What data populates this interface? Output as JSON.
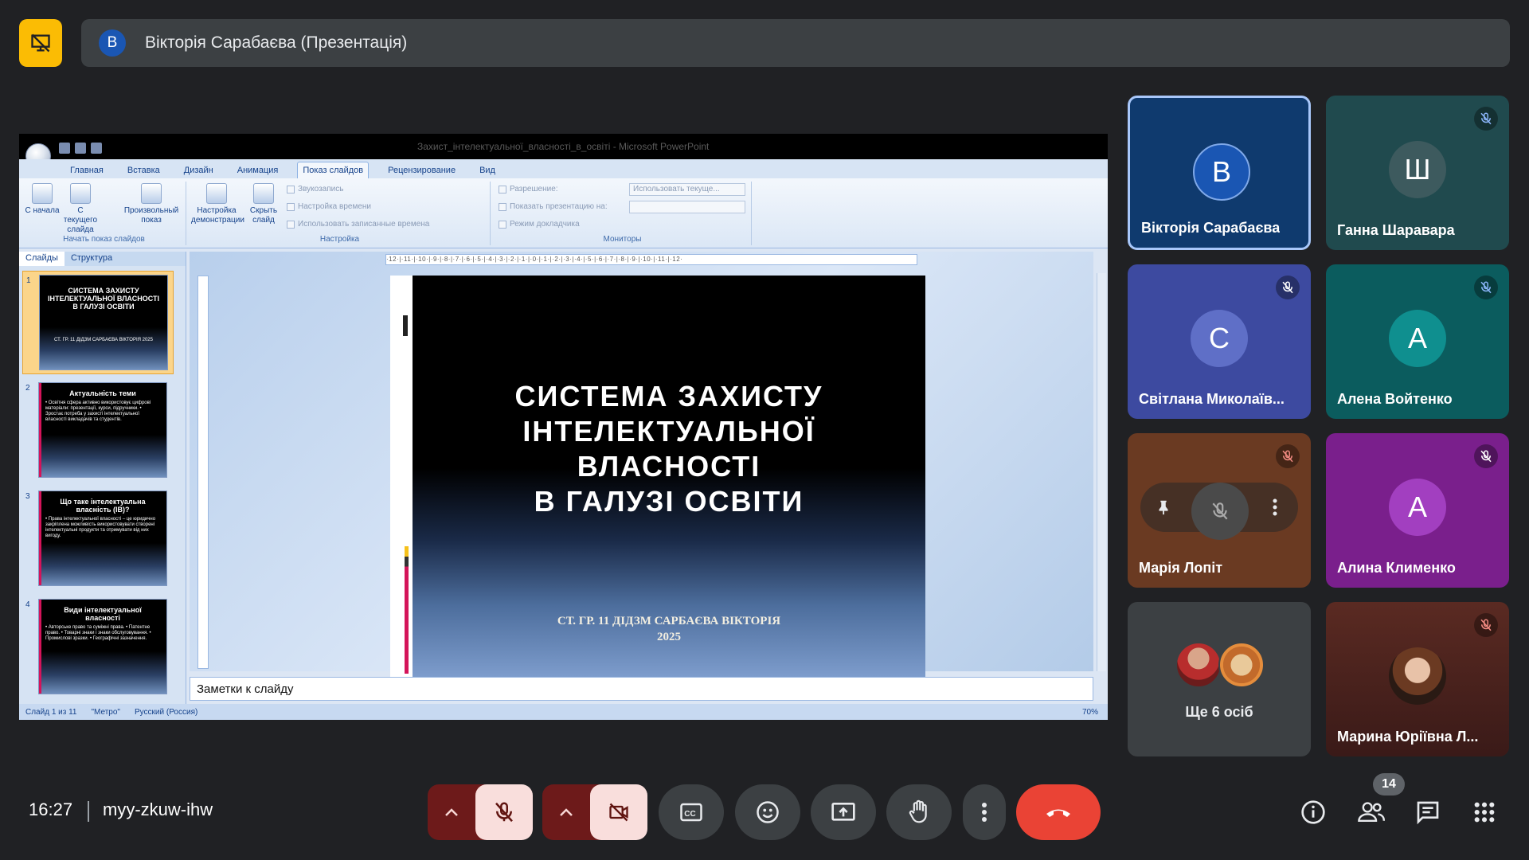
{
  "presenter_bar": {
    "avatar_letter": "В",
    "title": "Вікторія Сарабаєва (Презентація)"
  },
  "powerpoint": {
    "doc_title": "Захист_інтелектуальної_власності_в_освіті - Microsoft PowerPoint",
    "tabs": [
      "Главная",
      "Вставка",
      "Дизайн",
      "Анимация",
      "Показ слайдов",
      "Рецензирование",
      "Вид"
    ],
    "active_tab": "Показ слайдов",
    "ribbon": {
      "group1_label": "Начать показ слайдов",
      "btn_from_start": "С начала",
      "btn_from_current": "С текущего слайда",
      "btn_custom": "Произвольный показ",
      "group2_label": "Настройка",
      "btn_setup": "Настройка демонстрации",
      "btn_hide": "Скрыть слайд",
      "opt_record": "Звукозапись",
      "opt_rehearse": "Настройка времени",
      "opt_use_timings": "Использовать записанные времена",
      "group3_label": "Мониторы",
      "resolution_label": "Разрешение:",
      "resolution_value": "Использовать текуще...",
      "show_on_label": "Показать презентацию на:",
      "presenter_view": "Режим докладчика"
    },
    "panel_tabs": [
      "Слайды",
      "Структура"
    ],
    "thumbnails": [
      {
        "num": "1",
        "title": "СИСТЕМА ЗАХИСТУ ІНТЕЛЕКТУАЛЬНОЇ ВЛАСНОСТІ В ГАЛУЗІ ОСВІТИ",
        "body": "СТ. ГР. 11 ДІДЗМ САРБАЄВА ВІКТОРІЯ 2025"
      },
      {
        "num": "2",
        "title": "Актуальність теми",
        "body": "• Освітня сфера активно використовує цифрові матеріали: презентації, курси, підручники. • Зростає потреба у захисті інтелектуальної власності викладачів та студентів."
      },
      {
        "num": "3",
        "title": "Що таке інтелектуальна власність (ІВ)?",
        "body": "• Права інтелектуальної власності – це юридично закріплена можливість використовувати створені інтелектуальні продукти та отримувати від них вигоду."
      },
      {
        "num": "4",
        "title": "Види інтелектуальної власності",
        "body": "• Авторське право та суміжні права. • Патентне право. • Товарні знаки і знаки обслуговування. • Промислові зразки. • Географічні зазначення."
      }
    ],
    "ruler_text": "·12·|·11·|·10·|·9·|·8·|·7·|·6·|·5·|·4·|·3·|·2·|·1·|·0·|·1·|·2·|·3·|·4·|·5·|·6·|·7·|·8·|·9·|·10·|·11·|·12·",
    "slide": {
      "title_line1": "СИСТЕМА ЗАХИСТУ",
      "title_line2": "ІНТЕЛЕКТУАЛЬНОЇ",
      "title_line3": "ВЛАСНОСТІ",
      "title_line4": "В ГАЛУЗІ ОСВІТИ",
      "subtitle_line1": "СТ. ГР. 11 ДІДЗМ САРБАЄВА ВІКТОРІЯ",
      "subtitle_line2": "2025"
    },
    "notes_placeholder": "Заметки к слайду",
    "status": {
      "slide_count": "Слайд 1 из 11",
      "theme": "\"Метро\"",
      "language": "Русский (Россия)",
      "zoom": "70%"
    }
  },
  "participants": [
    {
      "letter": "В",
      "name": "Вікторія Сарабаєва",
      "color": "#1a56b3",
      "bg": "#0f3a6e",
      "muted": false,
      "active": true
    },
    {
      "letter": "Ш",
      "name": "Ганна Шаравара",
      "color": "#3d5a5e",
      "bg": "#204a4e",
      "muted": true,
      "active": false
    },
    {
      "letter": "С",
      "name": "Світлана Миколаїв...",
      "color": "#5f6fc7",
      "bg": "#3d4aa0",
      "muted": true,
      "active": false
    },
    {
      "letter": "А",
      "name": "Алена Войтенко",
      "color": "#0f8f8f",
      "bg": "#0b5c5e",
      "muted": true,
      "active": false
    },
    {
      "letter": "",
      "name": "Марія Лопіт",
      "color": "#555",
      "bg": "#6a3a22",
      "muted": true,
      "active": false
    },
    {
      "letter": "А",
      "name": "Алина Клименко",
      "color": "#a23fc0",
      "bg": "#7a1f8c",
      "muted": true,
      "active": false
    },
    {
      "letter": "",
      "name": "Марина Юріївна Л...",
      "color": "#7a4a2a",
      "bg": "#6e2a1e",
      "muted": true,
      "active": false
    }
  ],
  "more_tile": {
    "label": "Ще 6 осіб"
  },
  "bottom_bar": {
    "time": "16:27",
    "meeting_code": "myy-zkuw-ihw",
    "people_count": "14"
  },
  "colors": {
    "background": "#202124",
    "present_accent": "#fbbc04",
    "end_call": "#ea4335",
    "muted_control_bg": "#f9dedc",
    "muted_control_split": "#6d1a1a"
  }
}
